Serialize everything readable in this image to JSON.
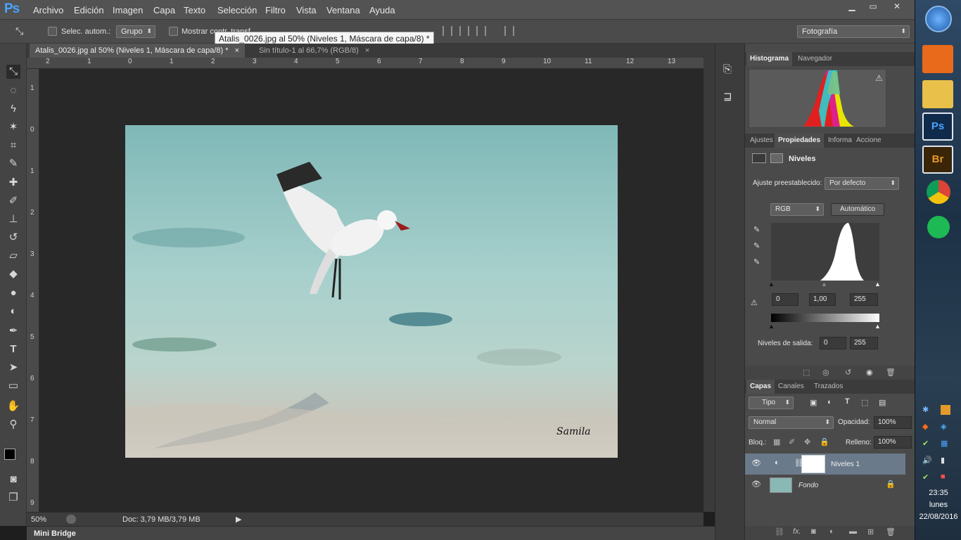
{
  "app": {
    "logo": "Ps"
  },
  "menu": [
    "Archivo",
    "Edición",
    "Imagen",
    "Capa",
    "Texto",
    "Selección",
    "Filtro",
    "Vista",
    "Ventana",
    "Ayuda"
  ],
  "window_controls": [
    "▁",
    "▭",
    "✕"
  ],
  "options": {
    "auto_select_label": "Selec. autom.:",
    "group_value": "Grupo",
    "show_transform_label": "Mostrar contr. transf.",
    "workspace": "Fotografía"
  },
  "tooltip": "Atalis_0026.jpg al 50% (Niveles 1, Máscara de capa/8) *",
  "tabs": [
    {
      "label": "Atalis_0026.jpg al 50% (Niveles 1, Máscara de capa/8) *",
      "close": "×"
    },
    {
      "label": "Sin título-1 al 66,7% (RGB/8)",
      "close": "×"
    }
  ],
  "ruler_top": [
    "2",
    "1",
    "0",
    "1",
    "2",
    "3",
    "4",
    "5",
    "6",
    "7",
    "8",
    "9",
    "10",
    "11",
    "12",
    "13"
  ],
  "ruler_left": [
    "1",
    "0",
    "1",
    "2",
    "3",
    "4",
    "5",
    "6",
    "7",
    "8",
    "9"
  ],
  "status": {
    "zoom": "50%",
    "doc": "Doc: 3,79 MB/3,79 MB"
  },
  "minibridge": "Mini Bridge",
  "signature": "Samila",
  "panels": {
    "histogram_tabs": [
      "Histograma",
      "Navegador"
    ],
    "props_tabs": [
      "Ajustes",
      "Propiedades",
      "Informa",
      "Accione"
    ],
    "props_title": "Niveles",
    "preset_label": "Ajuste preestablecido:",
    "preset_value": "Por defecto",
    "channel": "RGB",
    "auto_button": "Automático",
    "input_levels": [
      "0",
      "1,00",
      "255"
    ],
    "output_label": "Niveles de salida:",
    "output_levels": [
      "0",
      "255"
    ],
    "layers_tabs": [
      "Capas",
      "Canales",
      "Trazados"
    ],
    "kind_filter": "Tipo",
    "blend_mode": "Normal",
    "opacity_label": "Opacidad:",
    "opacity_value": "100%",
    "lock_label": "Bloq.:",
    "fill_label": "Relleno:",
    "fill_value": "100%",
    "layers": [
      {
        "name": "Niveles 1"
      },
      {
        "name": "Fondo"
      }
    ]
  },
  "tray": {
    "time": "23:35",
    "day": "lunes",
    "date": "22/08/2016"
  },
  "colors": {
    "accent": "#4aa3ff",
    "canvas": "#282828",
    "panel": "#4a4a4a"
  }
}
